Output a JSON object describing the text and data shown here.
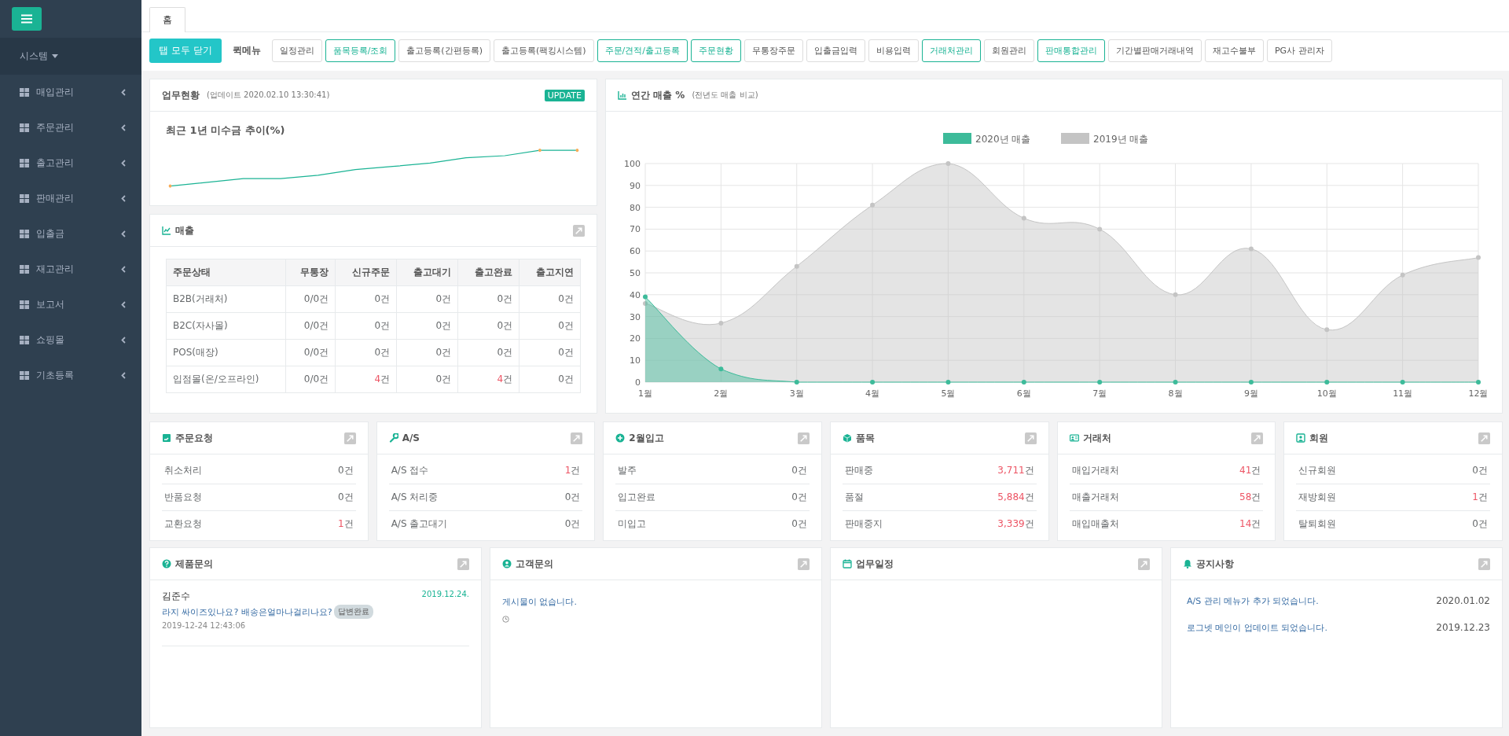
{
  "sidebar": {
    "section": "시스템",
    "items": [
      "매입관리",
      "주문관리",
      "출고관리",
      "판매관리",
      "입출금",
      "재고관리",
      "보고서",
      "쇼핑몰",
      "기초등록"
    ]
  },
  "tabs": [
    {
      "label": "홈",
      "selected": true
    }
  ],
  "quick_menu": {
    "close_all": "탭 모두 닫기",
    "label": "퀵메뉴",
    "items": [
      {
        "label": "일정관리",
        "highlighted": false
      },
      {
        "label": "품목등록/조회",
        "highlighted": true
      },
      {
        "label": "출고등록(간편등록)",
        "highlighted": false
      },
      {
        "label": "출고등록(팩킹시스템)",
        "highlighted": false
      },
      {
        "label": "주문/견적/출고등록",
        "highlighted": true
      },
      {
        "label": "주문현황",
        "highlighted": true
      },
      {
        "label": "무통장주문",
        "highlighted": false
      },
      {
        "label": "입출금입력",
        "highlighted": false
      },
      {
        "label": "비용입력",
        "highlighted": false
      },
      {
        "label": "거래처관리",
        "highlighted": true
      },
      {
        "label": "회원관리",
        "highlighted": false
      },
      {
        "label": "판매통합관리",
        "highlighted": true
      },
      {
        "label": "기간별판매거래내역",
        "highlighted": false
      },
      {
        "label": "재고수불부",
        "highlighted": false
      },
      {
        "label": "PG사 관리자",
        "highlighted": false
      }
    ]
  },
  "status_panel": {
    "title": "업무현황",
    "updated": "(업데이트 2020.02.10 13:30:41)",
    "badge": "UPDATE",
    "chart_title": "최근 1년 미수금 추이(%)"
  },
  "sales_panel": {
    "title": "매출",
    "columns": [
      "주문상태",
      "무통장",
      "신규주문",
      "출고대기",
      "출고완료",
      "출고지연"
    ],
    "rows": [
      {
        "cells": [
          {
            "value": "B2B(거래처)"
          },
          {
            "value": "0/0",
            "unit": "건",
            "alert": false
          },
          {
            "value": "0",
            "unit": "건",
            "alert": false
          },
          {
            "value": "0",
            "unit": "건",
            "alert": false
          },
          {
            "value": "0",
            "unit": "건",
            "alert": false
          },
          {
            "value": "0",
            "unit": "건",
            "alert": false
          }
        ]
      },
      {
        "cells": [
          {
            "value": "B2C(자사몰)"
          },
          {
            "value": "0/0",
            "unit": "건",
            "alert": false
          },
          {
            "value": "0",
            "unit": "건",
            "alert": false
          },
          {
            "value": "0",
            "unit": "건",
            "alert": false
          },
          {
            "value": "0",
            "unit": "건",
            "alert": false
          },
          {
            "value": "0",
            "unit": "건",
            "alert": false
          }
        ]
      },
      {
        "cells": [
          {
            "value": "POS(매장)"
          },
          {
            "value": "0/0",
            "unit": "건",
            "alert": false
          },
          {
            "value": "0",
            "unit": "건",
            "alert": false
          },
          {
            "value": "0",
            "unit": "건",
            "alert": false
          },
          {
            "value": "0",
            "unit": "건",
            "alert": false
          },
          {
            "value": "0",
            "unit": "건",
            "alert": false
          }
        ]
      },
      {
        "cells": [
          {
            "value": "입점몰(온/오프라인)"
          },
          {
            "value": "0/0",
            "unit": "건",
            "alert": false
          },
          {
            "value": "4",
            "unit": "건",
            "alert": true
          },
          {
            "value": "0",
            "unit": "건",
            "alert": false
          },
          {
            "value": "4",
            "unit": "건",
            "alert": true
          },
          {
            "value": "0",
            "unit": "건",
            "alert": false
          }
        ]
      }
    ]
  },
  "annual_chart": {
    "title": "연간 매출 %",
    "subtitle": "(전년도 매출 비교)",
    "chart_data": {
      "type": "area",
      "grid": true,
      "legend": "top",
      "categories": [
        "1월",
        "2월",
        "3월",
        "4월",
        "5월",
        "6월",
        "7월",
        "8월",
        "9월",
        "10월",
        "11월",
        "12월"
      ],
      "ylim": [
        0,
        100
      ],
      "yticks": [
        0,
        10,
        20,
        30,
        40,
        50,
        60,
        70,
        80,
        90,
        100
      ],
      "series": [
        {
          "name": "2020년 매출",
          "color": "#3dbb9a",
          "values": [
            39,
            6,
            0,
            0,
            0,
            0,
            0,
            0,
            0,
            0,
            0,
            0
          ]
        },
        {
          "name": "2019년 매출",
          "color": "#c4c4c4",
          "values": [
            36,
            27,
            53,
            81,
            100,
            75,
            70,
            40,
            61,
            24,
            49,
            57
          ]
        }
      ]
    }
  },
  "stat_cards": [
    {
      "title": "주문요청",
      "rows": [
        {
          "label": "취소처리",
          "value": "0",
          "unit": "건",
          "alert": false
        },
        {
          "label": "반품요청",
          "value": "0",
          "unit": "건",
          "alert": false
        },
        {
          "label": "교환요청",
          "value": "1",
          "unit": "건",
          "alert": true
        }
      ]
    },
    {
      "title": "A/S",
      "rows": [
        {
          "label": "A/S 접수",
          "value": "1",
          "unit": "건",
          "alert": true
        },
        {
          "label": "A/S 처리중",
          "value": "0",
          "unit": "건",
          "alert": false
        },
        {
          "label": "A/S 출고대기",
          "value": "0",
          "unit": "건",
          "alert": false
        }
      ]
    },
    {
      "title": "2월입고",
      "rows": [
        {
          "label": "발주",
          "value": "0",
          "unit": "건",
          "alert": false
        },
        {
          "label": "입고완료",
          "value": "0",
          "unit": "건",
          "alert": false
        },
        {
          "label": "미입고",
          "value": "0",
          "unit": "건",
          "alert": false
        }
      ]
    },
    {
      "title": "품목",
      "rows": [
        {
          "label": "판매중",
          "value": "3,711",
          "unit": "건",
          "alert": true
        },
        {
          "label": "품절",
          "value": "5,884",
          "unit": "건",
          "alert": true
        },
        {
          "label": "판매중지",
          "value": "3,339",
          "unit": "건",
          "alert": true
        }
      ]
    },
    {
      "title": "거래처",
      "rows": [
        {
          "label": "매입거래처",
          "value": "41",
          "unit": "건",
          "alert": true
        },
        {
          "label": "매출거래처",
          "value": "58",
          "unit": "건",
          "alert": true
        },
        {
          "label": "매입매출처",
          "value": "14",
          "unit": "건",
          "alert": true
        }
      ]
    },
    {
      "title": "회원",
      "rows": [
        {
          "label": "신규회원",
          "value": "0",
          "unit": "건",
          "alert": false
        },
        {
          "label": "재방회원",
          "value": "1",
          "unit": "건",
          "alert": true
        },
        {
          "label": "탈퇴회원",
          "value": "0",
          "unit": "건",
          "alert": false
        }
      ]
    }
  ],
  "product_inquiry": {
    "title": "제품문의",
    "posts": [
      {
        "author": "김준수",
        "date": "2019.12.24.",
        "question": "라지 싸이즈있나요? 배송은얼마나걸리나요?",
        "badge": "답변완료",
        "time": "2019-12-24 12:43:06"
      }
    ]
  },
  "customer_inquiry": {
    "title": "고객문의",
    "empty_text": "게시물이 없습니다."
  },
  "schedule": {
    "title": "업무일정"
  },
  "notices": {
    "title": "공지사항",
    "items": [
      {
        "text": "A/S 관리 메뉴가 추가 되었습니다.",
        "date": "2020.01.02"
      },
      {
        "text": "로그넷 메인이 업데이트 되었습니다.",
        "date": "2019.12.23"
      }
    ]
  }
}
